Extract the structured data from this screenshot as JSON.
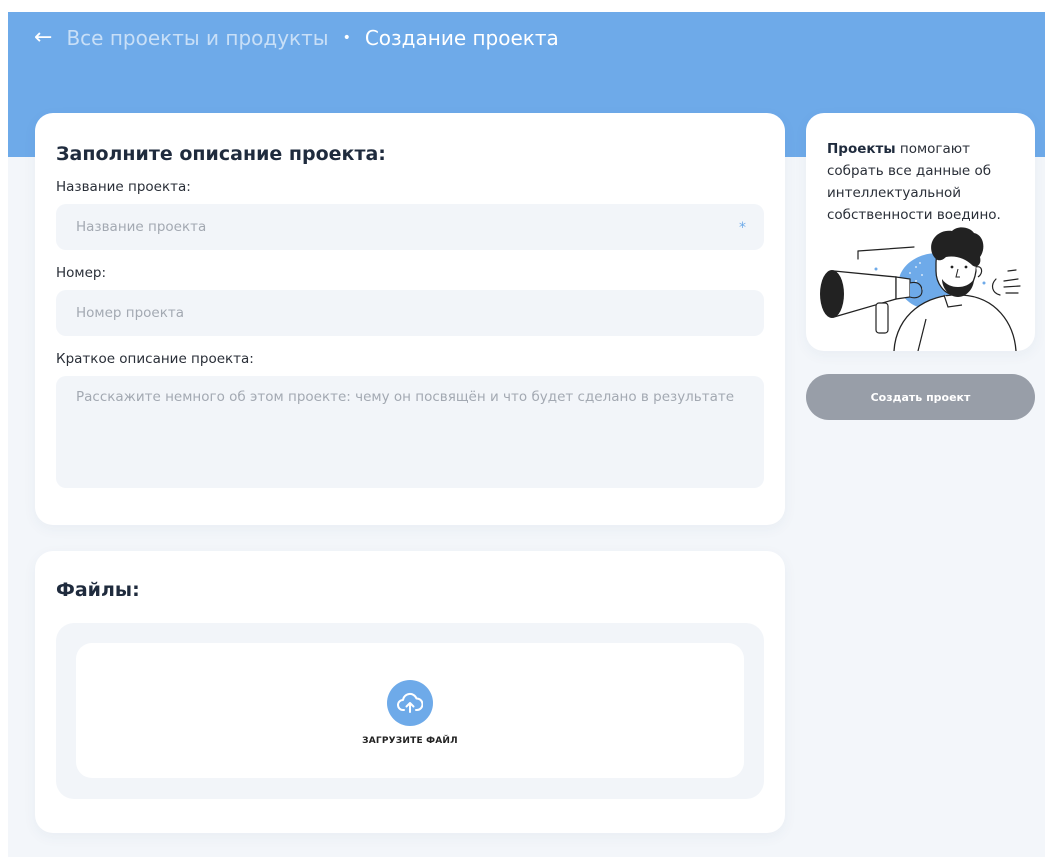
{
  "header": {
    "back_icon": "arrow-left-icon",
    "breadcrumb_link": "Все проекты и продукты",
    "separator": "•",
    "current": "Создание проекта"
  },
  "description_card": {
    "title": "Заполните описание проекта:",
    "name_label": "Название проекта:",
    "name_placeholder": "Название проекта",
    "name_required_mark": "*",
    "number_label": "Номер:",
    "number_placeholder": "Номер проекта",
    "summary_label": "Краткое описание проекта:",
    "summary_placeholder": "Расскажите немного об этом проекте: чему он посвящён и что будет сделано в результате"
  },
  "files_card": {
    "title": "Файлы:",
    "upload_icon": "cloud-upload-icon",
    "upload_label": "ЗАГРУЗИТЕ ФАЙЛ"
  },
  "info_card": {
    "bold_word": "Проекты",
    "text": " помогают собрать все данные об интеллектуальной собственности воедино.",
    "illustration": "man-with-megaphone-illustration"
  },
  "actions": {
    "create_label": "Создать проект"
  },
  "colors": {
    "accent": "#6eaae9",
    "disabled_button": "#989ea8",
    "page_background": "#f3f6fa"
  }
}
